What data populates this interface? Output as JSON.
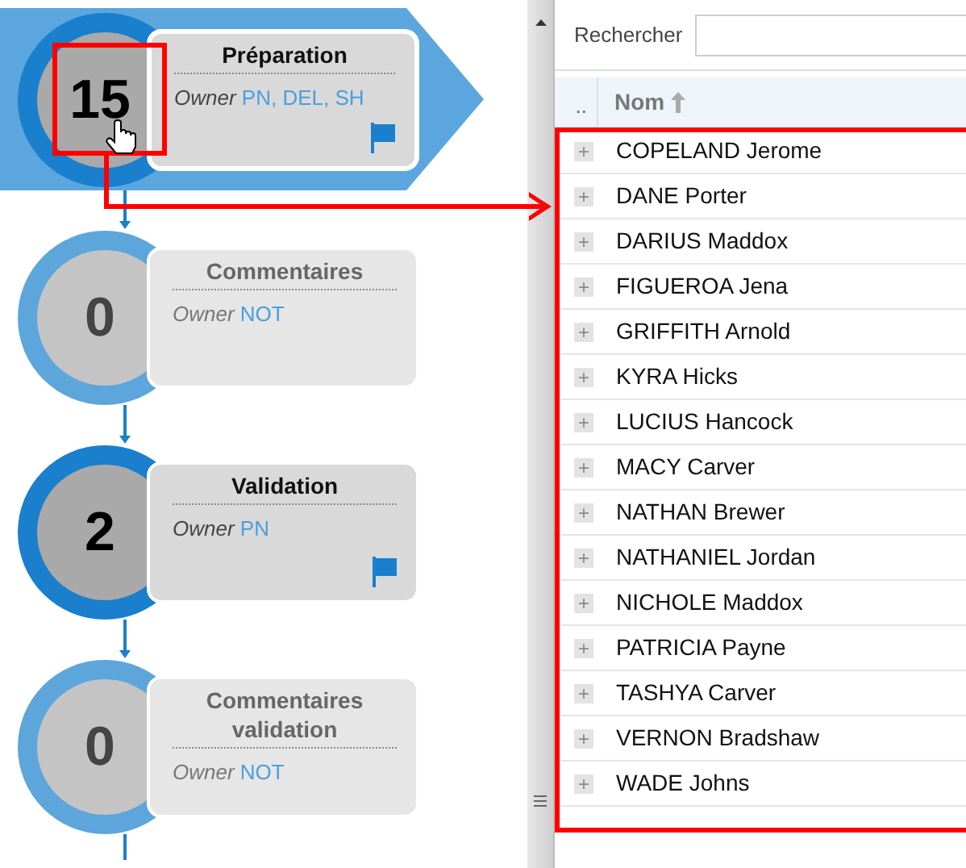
{
  "steps": [
    {
      "count": "15",
      "title": "Préparation",
      "owner_label": "Owner",
      "owners": "PN, DEL, SH",
      "flag": true,
      "selected": true,
      "kind": "filled"
    },
    {
      "count": "0",
      "title": "Commentaires",
      "owner_label": "Owner",
      "owners": "NOT",
      "flag": false,
      "selected": false,
      "kind": "empty"
    },
    {
      "count": "2",
      "title": "Validation",
      "owner_label": "Owner",
      "owners": "PN",
      "flag": true,
      "selected": false,
      "kind": "filled"
    },
    {
      "count": "0",
      "title": "Commentaires validation",
      "owner_label": "Owner",
      "owners": "NOT",
      "flag": false,
      "selected": false,
      "kind": "empty"
    }
  ],
  "search": {
    "label": "Rechercher"
  },
  "table": {
    "columns": [
      "..",
      "Nom"
    ],
    "rows": [
      {
        "name": "COPELAND Jerome",
        "expand": "+"
      },
      {
        "name": "DANE Porter",
        "expand": "+"
      },
      {
        "name": "DARIUS Maddox",
        "expand": "+"
      },
      {
        "name": "FIGUEROA Jena",
        "expand": "+"
      },
      {
        "name": "GRIFFITH Arnold",
        "expand": "+"
      },
      {
        "name": "KYRA Hicks",
        "expand": "+"
      },
      {
        "name": "LUCIUS Hancock",
        "expand": "+"
      },
      {
        "name": "MACY Carver",
        "expand": "+"
      },
      {
        "name": "NATHAN Brewer",
        "expand": "+"
      },
      {
        "name": "NATHANIEL Jordan",
        "expand": "+"
      },
      {
        "name": "NICHOLE Maddox",
        "expand": "+"
      },
      {
        "name": "PATRICIA Payne",
        "expand": "+"
      },
      {
        "name": "TASHYA Carver",
        "expand": "+"
      },
      {
        "name": "VERNON Bradshaw",
        "expand": "+"
      },
      {
        "name": "WADE Johns",
        "expand": "+"
      }
    ]
  }
}
